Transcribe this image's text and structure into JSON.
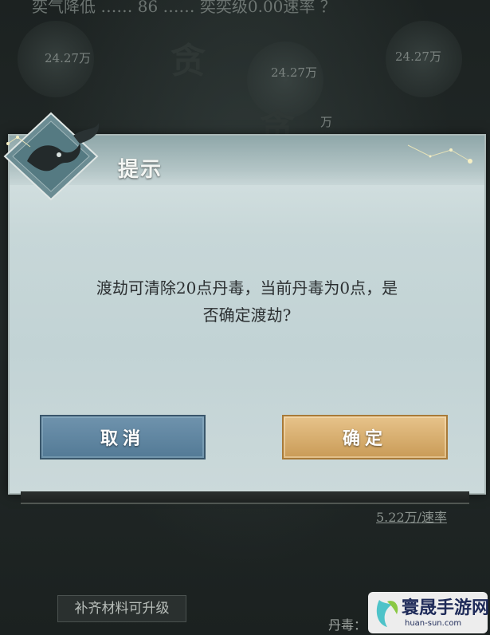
{
  "background": {
    "top_line": "奕气降低 …… 86 …… 奕奕级0.00速率 ？",
    "values": [
      "24.27万",
      "24.27万",
      "24.27万",
      "万"
    ],
    "bottom_note": "5.22万/速率",
    "badge_label": "补齐材料可升级",
    "bottom_text": "丹毒："
  },
  "dialog": {
    "title": "提示",
    "message_line1": "渡劫可清除20点丹毒，当前丹毒为0点，是",
    "message_line2": "否确定渡劫?",
    "cancel_label": "取消",
    "confirm_label": "确定"
  },
  "watermark": {
    "name": "寰晟手游网",
    "url": "huan-sun.com"
  },
  "colors": {
    "cancel_button": "#5f87a3",
    "confirm_button": "#d9b070",
    "dialog_bg": "#c7d7d8",
    "title_text": "#f4f6f3"
  }
}
